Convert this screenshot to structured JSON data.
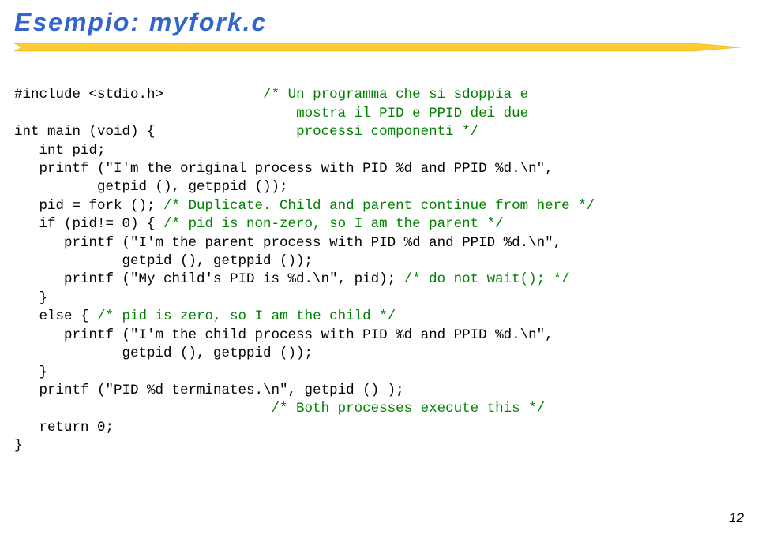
{
  "title": "Esempio: myfork.c",
  "pagenum": "12",
  "code": {
    "l01a": "#include <stdio.h>",
    "l01b": "/* Un programma che si sdoppia e",
    "l02b": "mostra il PID e PPID dei due",
    "l03a": "int main (void) {",
    "l03b": "processi componenti */",
    "l04": "   int pid;",
    "l05": "   printf (\"I'm the original process with PID %d and PPID %d.\\n\",",
    "l06": "          getpid (), getppid ());",
    "l07a": "   pid = fork (); ",
    "l07b": "/* Duplicate. Child and parent continue from here */",
    "l08a": "   if (pid!= 0) { ",
    "l08b": "/* pid is non-zero, so I am the parent */",
    "l09": "      printf (\"I'm the parent process with PID %d and PPID %d.\\n\",",
    "l10": "             getpid (), getppid ());",
    "l11a": "      printf (\"My child's PID is %d.\\n\", pid); ",
    "l11b": "/* do not wait(); */",
    "l12": "   }",
    "l13a": "   else { ",
    "l13b": "/* pid is zero, so I am the child */",
    "l14": "      printf (\"I'm the child process with PID %d and PPID %d.\\n\",",
    "l15": "             getpid (), getppid ());",
    "l16": "   }",
    "l17": "   printf (\"PID %d terminates.\\n\", getpid () );",
    "l18": "                               /* Both processes execute this */",
    "l19": "   return 0;",
    "l20": "}"
  }
}
